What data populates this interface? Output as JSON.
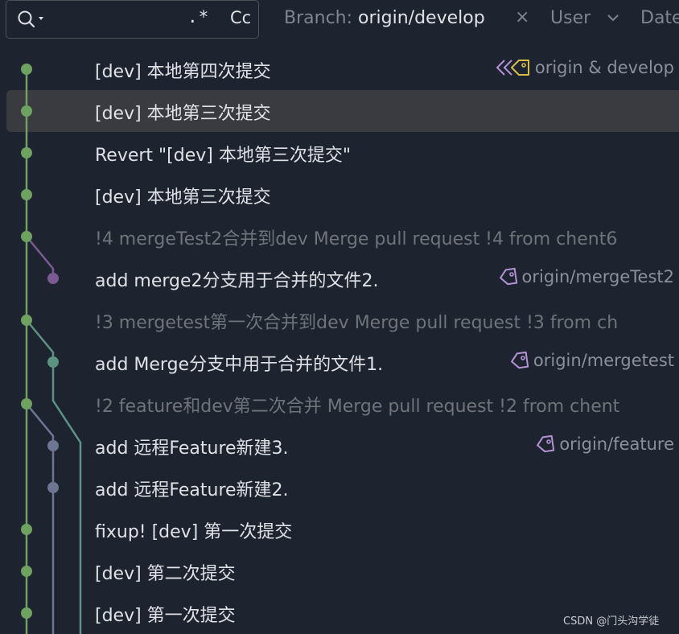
{
  "toolbar": {
    "regex_label": ".*",
    "case_label": "Cc",
    "branch_label": "Branch:",
    "branch_value": "origin/develop",
    "branch_clear": "×",
    "user_label": "User",
    "date_label": "Date"
  },
  "colors": {
    "background": "#1e2330",
    "selection": "#393b40",
    "lane_main": "#6fa161",
    "lane_purple": "#7b5a91",
    "lane_teal": "#5c9280",
    "lane_slate": "#6c7691",
    "ref_icon": "#b393d6",
    "ref_icon_yellow": "#d6bc4b"
  },
  "commits": [
    {
      "message": "[dev] 本地第四次提交",
      "ref": "origin & develop",
      "ref_icon": "multi-ref-icon"
    },
    {
      "message": "[dev] 本地第三次提交",
      "selected": true
    },
    {
      "message": "Revert \"[dev] 本地第三次提交\""
    },
    {
      "message": "[dev] 本地第三次提交"
    },
    {
      "message": "!4 mergeTest2合并到dev Merge pull request !4 from chent6",
      "merge": true
    },
    {
      "message": "add merge2分支用于合并的文件2.",
      "ref": "origin/mergeTest2",
      "ref_icon": "tag-icon"
    },
    {
      "message": "!3 mergetest第一次合并到dev Merge pull request !3 from ch",
      "merge": true
    },
    {
      "message": "add Merge分支中用于合并的文件1.",
      "ref": "origin/mergetest",
      "ref_icon": "tag-icon"
    },
    {
      "message": "!2 feature和dev第二次合并 Merge pull request !2 from chent",
      "merge": true
    },
    {
      "message": "add 远程Feature新建3.",
      "ref": "origin/feature",
      "ref_icon": "tag-icon"
    },
    {
      "message": "add 远程Feature新建2."
    },
    {
      "message": "fixup! [dev] 第一次提交"
    },
    {
      "message": "[dev] 第二次提交"
    },
    {
      "message": "[dev] 第一次提交"
    }
  ],
  "watermark": "CSDN @门头沟学徒"
}
